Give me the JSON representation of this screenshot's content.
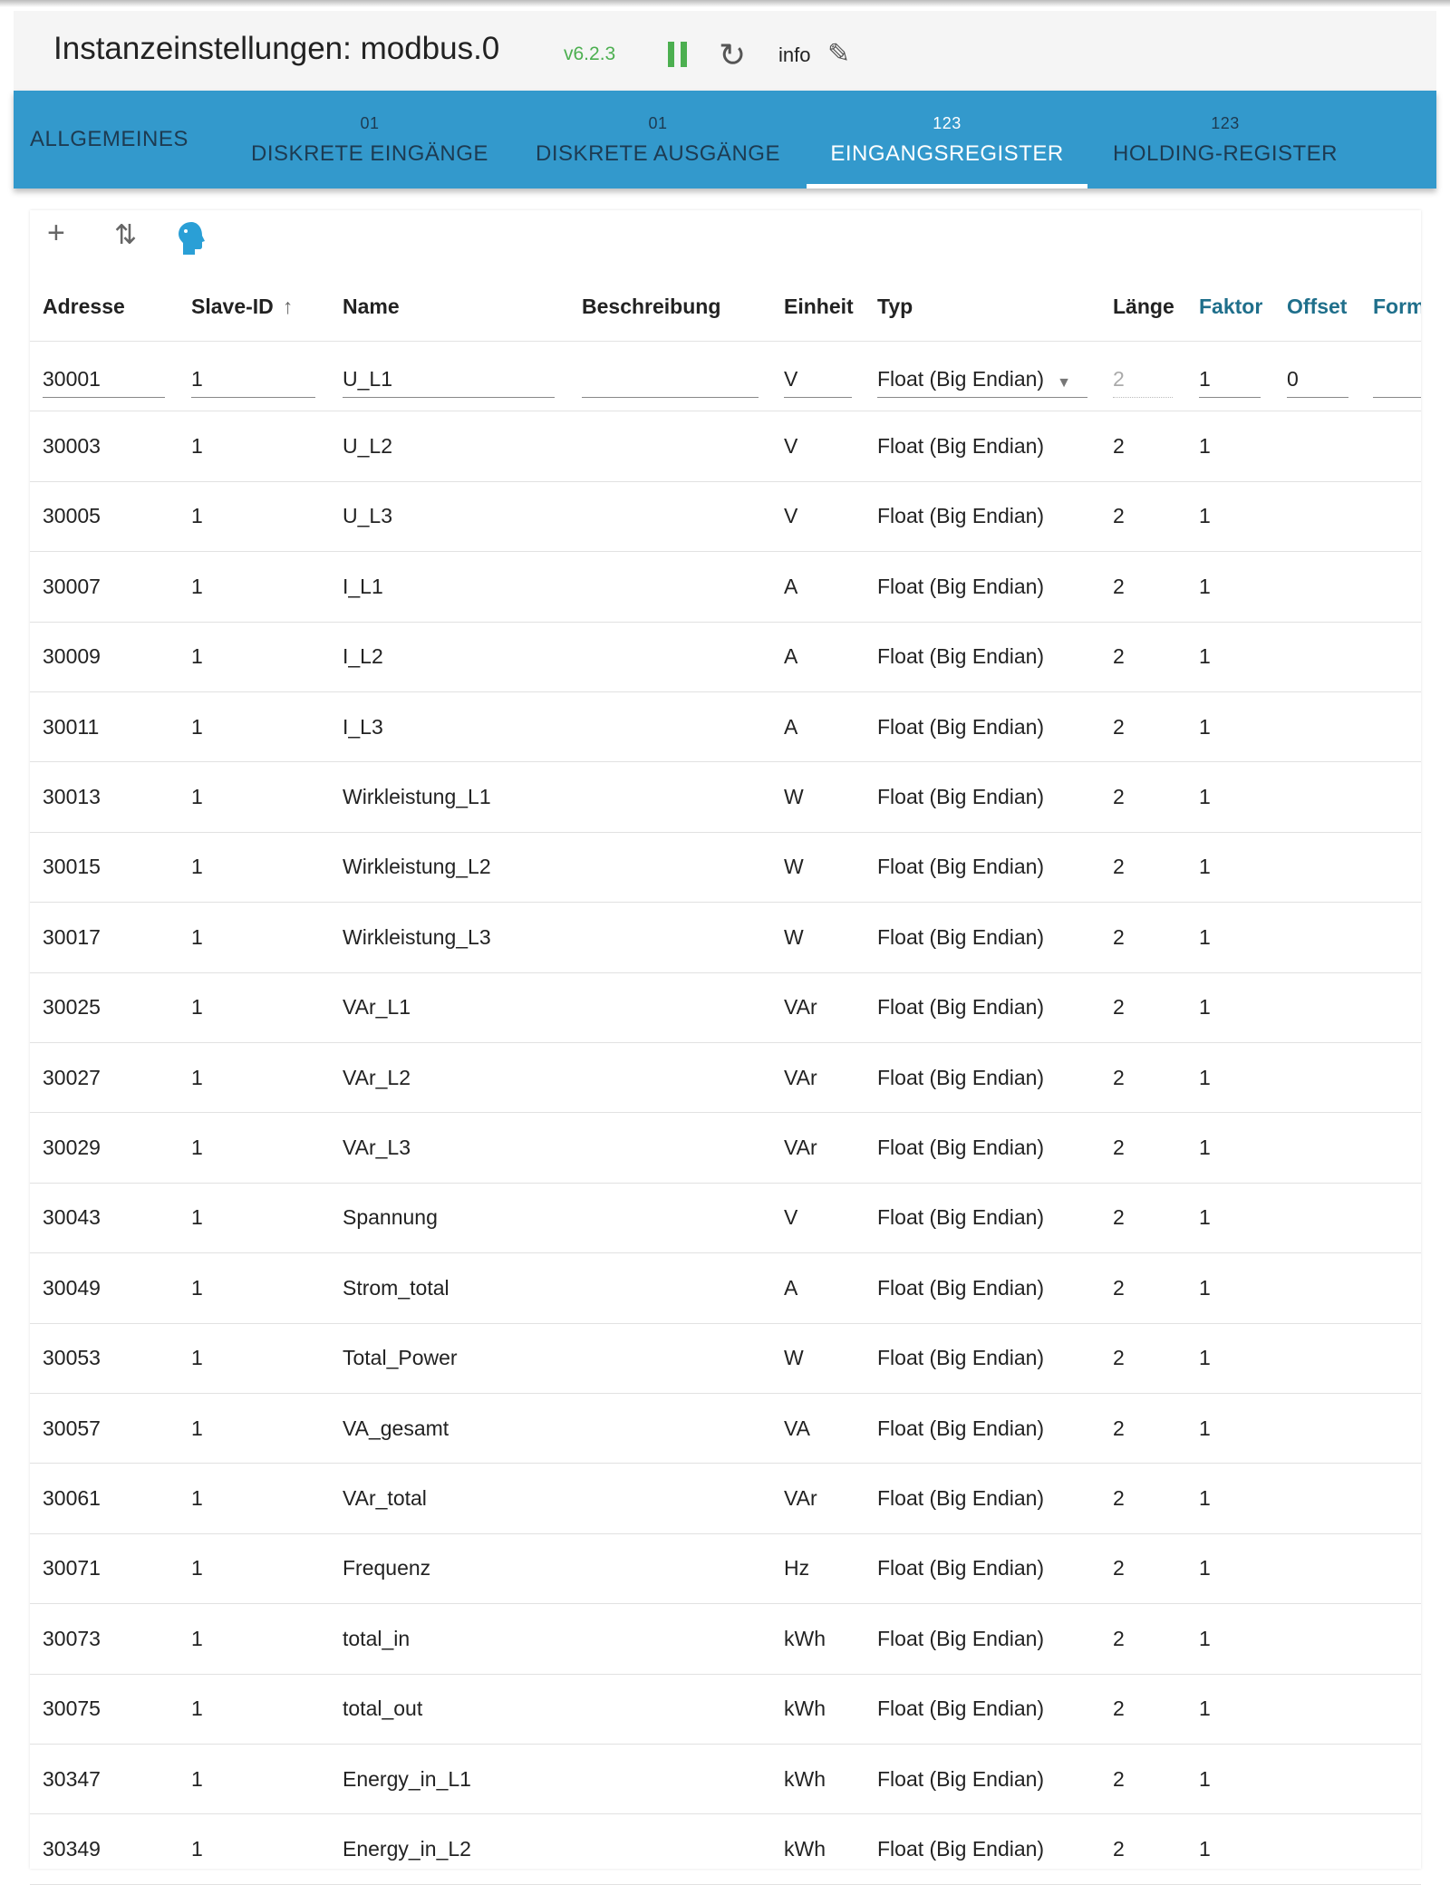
{
  "header": {
    "title": "Instanzeinstellungen: modbus.0",
    "version": "v6.2.3",
    "info_label": "info",
    "icons": [
      "pause-icon",
      "reload-icon",
      "pencil-icon"
    ]
  },
  "tabs": [
    {
      "label": "ALLGEMEINES",
      "icon": ""
    },
    {
      "label": "DISKRETE EINGÄNGE",
      "icon": "01"
    },
    {
      "label": "DISKRETE AUSGÄNGE",
      "icon": "01"
    },
    {
      "label": "EINGANGSREGISTER",
      "icon": "123",
      "active": true
    },
    {
      "label": "HOLDING-REGISTER",
      "icon": "123"
    }
  ],
  "toolbar": {
    "add": "+",
    "sort": "⇅",
    "icons": [
      "plus-icon",
      "sort-icon",
      "expert-head-icon"
    ]
  },
  "columns": [
    "Adresse",
    "Slave-ID",
    "Name",
    "Beschreibung",
    "Einheit",
    "Typ",
    "Länge",
    "Faktor",
    "Offset",
    "Form"
  ],
  "sort_indicator": "↑",
  "colors": {
    "tabbar": "#3399cc",
    "accent_green": "#4caf50",
    "link_header": "#1f6f8b"
  },
  "edit_row": {
    "address": "30001",
    "slave": "1",
    "name": "U_L1",
    "description": "",
    "unit": "V",
    "type": "Float (Big Endian)",
    "length": "2",
    "factor": "1",
    "offset": "0",
    "form": ""
  },
  "rows": [
    [
      "30003",
      "1",
      "U_L2",
      "",
      "V",
      "Float (Big Endian)",
      "2",
      "1"
    ],
    [
      "30005",
      "1",
      "U_L3",
      "",
      "V",
      "Float (Big Endian)",
      "2",
      "1"
    ],
    [
      "30007",
      "1",
      "I_L1",
      "",
      "A",
      "Float (Big Endian)",
      "2",
      "1"
    ],
    [
      "30009",
      "1",
      "I_L2",
      "",
      "A",
      "Float (Big Endian)",
      "2",
      "1"
    ],
    [
      "30011",
      "1",
      "I_L3",
      "",
      "A",
      "Float (Big Endian)",
      "2",
      "1"
    ],
    [
      "30013",
      "1",
      "Wirkleistung_L1",
      "",
      "W",
      "Float (Big Endian)",
      "2",
      "1"
    ],
    [
      "30015",
      "1",
      "Wirkleistung_L2",
      "",
      "W",
      "Float (Big Endian)",
      "2",
      "1"
    ],
    [
      "30017",
      "1",
      "Wirkleistung_L3",
      "",
      "W",
      "Float (Big Endian)",
      "2",
      "1"
    ],
    [
      "30025",
      "1",
      "VAr_L1",
      "",
      "VAr",
      "Float (Big Endian)",
      "2",
      "1"
    ],
    [
      "30027",
      "1",
      "VAr_L2",
      "",
      "VAr",
      "Float (Big Endian)",
      "2",
      "1"
    ],
    [
      "30029",
      "1",
      "VAr_L3",
      "",
      "VAr",
      "Float (Big Endian)",
      "2",
      "1"
    ],
    [
      "30043",
      "1",
      "Spannung",
      "",
      "V",
      "Float (Big Endian)",
      "2",
      "1"
    ],
    [
      "30049",
      "1",
      "Strom_total",
      "",
      "A",
      "Float (Big Endian)",
      "2",
      "1"
    ],
    [
      "30053",
      "1",
      "Total_Power",
      "",
      "W",
      "Float (Big Endian)",
      "2",
      "1"
    ],
    [
      "30057",
      "1",
      "VA_gesamt",
      "",
      "VA",
      "Float (Big Endian)",
      "2",
      "1"
    ],
    [
      "30061",
      "1",
      "VAr_total",
      "",
      "VAr",
      "Float (Big Endian)",
      "2",
      "1"
    ],
    [
      "30071",
      "1",
      "Frequenz",
      "",
      "Hz",
      "Float (Big Endian)",
      "2",
      "1"
    ],
    [
      "30073",
      "1",
      "total_in",
      "",
      "kWh",
      "Float (Big Endian)",
      "2",
      "1"
    ],
    [
      "30075",
      "1",
      "total_out",
      "",
      "kWh",
      "Float (Big Endian)",
      "2",
      "1"
    ],
    [
      "30347",
      "1",
      "Energy_in_L1",
      "",
      "kWh",
      "Float (Big Endian)",
      "2",
      "1"
    ],
    [
      "30349",
      "1",
      "Energy_in_L2",
      "",
      "kWh",
      "Float (Big Endian)",
      "2",
      "1"
    ]
  ]
}
